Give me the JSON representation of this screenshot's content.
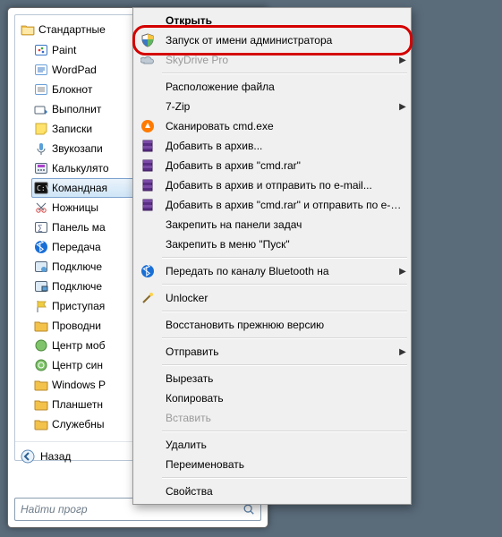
{
  "colors": {
    "highlight": "#d40000"
  },
  "tree": {
    "root_label": "Стандартные",
    "items": [
      {
        "label": "Paint",
        "icon": "paint"
      },
      {
        "label": "WordPad",
        "icon": "wordpad"
      },
      {
        "label": "Блокнот",
        "icon": "notepad"
      },
      {
        "label": "Выполнит",
        "icon": "run"
      },
      {
        "label": "Записки",
        "icon": "sticky"
      },
      {
        "label": "Звукозапи",
        "icon": "soundrec"
      },
      {
        "label": "Калькулято",
        "icon": "calc"
      },
      {
        "label": "Командная",
        "icon": "cmd",
        "selected": true
      },
      {
        "label": "Ножницы",
        "icon": "snip"
      },
      {
        "label": "Панель ма",
        "icon": "math"
      },
      {
        "label": "Передача",
        "icon": "bt"
      },
      {
        "label": "Подключе",
        "icon": "rdp"
      },
      {
        "label": "Подключе",
        "icon": "proj"
      },
      {
        "label": "Приступая",
        "icon": "flag"
      },
      {
        "label": "Проводни",
        "icon": "explorer"
      },
      {
        "label": "Центр моб",
        "icon": "mobility"
      },
      {
        "label": "Центр син",
        "icon": "sync"
      },
      {
        "label": "Windows P",
        "icon": "folder"
      },
      {
        "label": "Планшетн",
        "icon": "folder"
      },
      {
        "label": "Служебны",
        "icon": "folder"
      }
    ]
  },
  "back_label": "Назад",
  "search_placeholder": "Найти прогр",
  "context_menu": {
    "items": [
      {
        "label": "Открыть",
        "bold": true
      },
      {
        "label": "Запуск от имени администратора",
        "icon": "shield",
        "highlight": true
      },
      {
        "label": "SkyDrive Pro",
        "disabled": true,
        "icon": "cloud",
        "submenu": true
      },
      {
        "sep": true
      },
      {
        "label": "Расположение файла"
      },
      {
        "label": "7-Zip",
        "submenu": true
      },
      {
        "label": "Сканировать cmd.exe",
        "icon": "avast"
      },
      {
        "label": "Добавить в архив...",
        "icon": "rar"
      },
      {
        "label": "Добавить в архив \"cmd.rar\"",
        "icon": "rar"
      },
      {
        "label": "Добавить в архив и отправить по e-mail...",
        "icon": "rar"
      },
      {
        "label": "Добавить в архив \"cmd.rar\" и отправить по e-mail",
        "icon": "rar"
      },
      {
        "label": "Закрепить на панели задач"
      },
      {
        "label": "Закрепить в меню \"Пуск\""
      },
      {
        "sep": true
      },
      {
        "label": "Передать по каналу Bluetooth на",
        "icon": "bt",
        "submenu": true
      },
      {
        "sep": true
      },
      {
        "label": "Unlocker",
        "icon": "wand"
      },
      {
        "sep": true
      },
      {
        "label": "Восстановить прежнюю версию"
      },
      {
        "sep": true
      },
      {
        "label": "Отправить",
        "submenu": true
      },
      {
        "sep": true
      },
      {
        "label": "Вырезать"
      },
      {
        "label": "Копировать"
      },
      {
        "label": "Вставить",
        "disabled": true
      },
      {
        "sep": true
      },
      {
        "label": "Удалить"
      },
      {
        "label": "Переименовать"
      },
      {
        "sep": true
      },
      {
        "label": "Свойства"
      }
    ]
  }
}
